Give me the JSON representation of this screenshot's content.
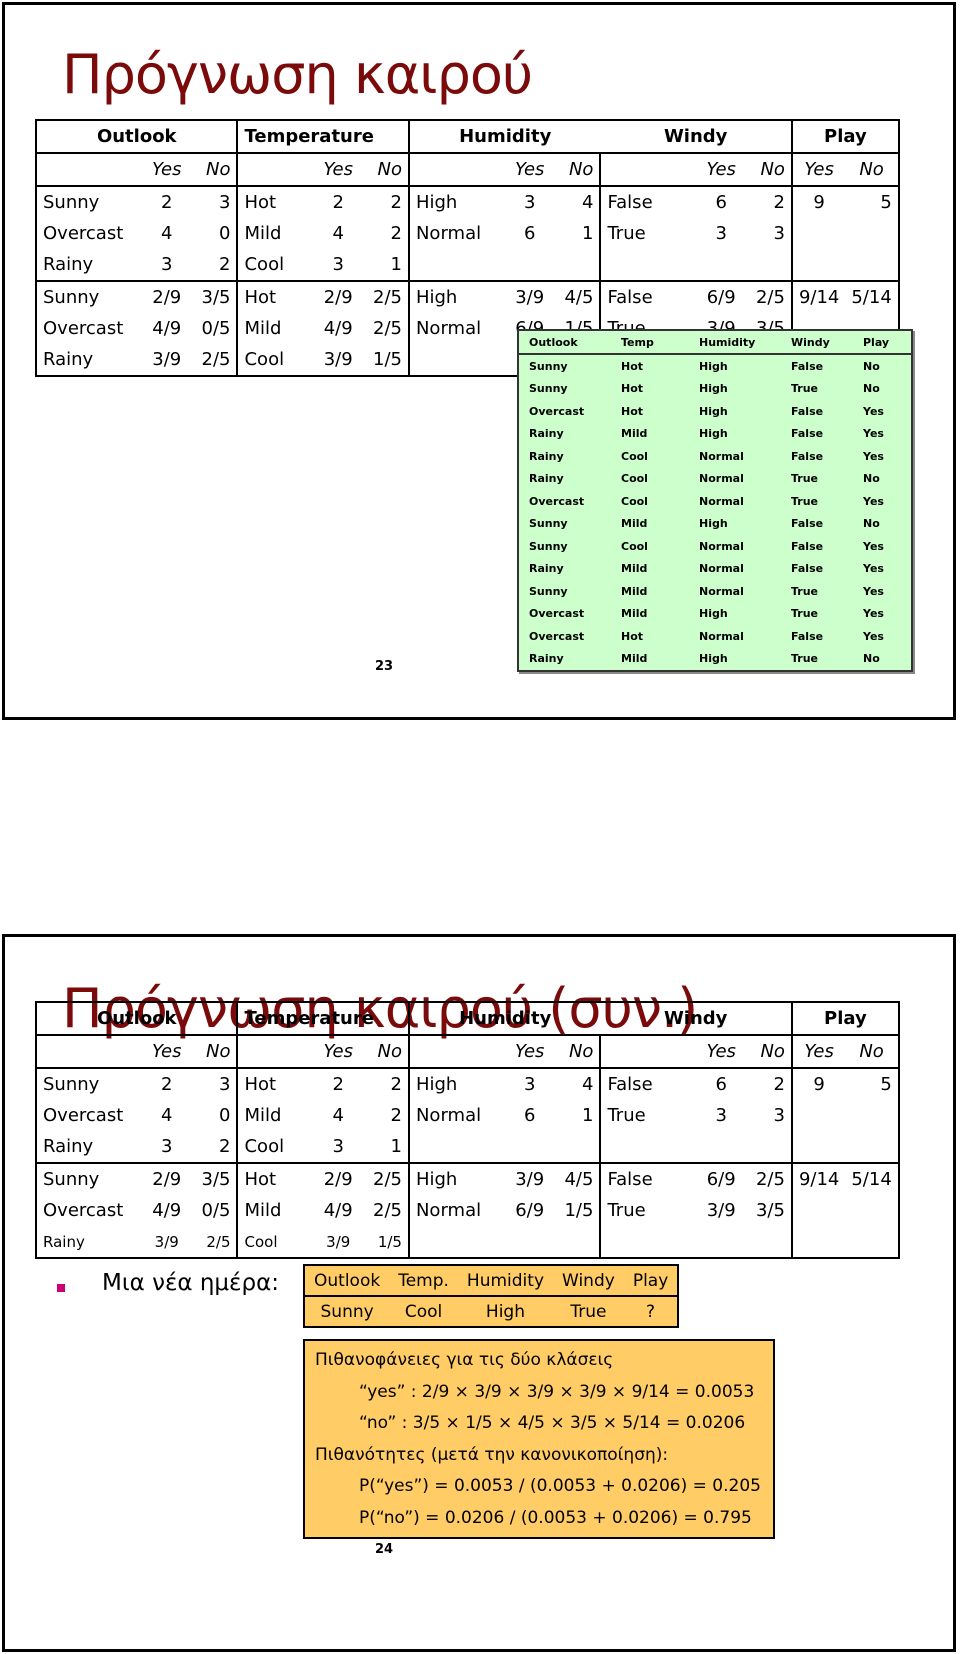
{
  "slides": [
    {
      "title": "Πρόγνωση καιρού",
      "page_number": "23"
    },
    {
      "title": "Πρόγνωση καιρού (συν.)",
      "page_number": "24"
    }
  ],
  "freq_table": {
    "headers": [
      "Outlook",
      "Temperature",
      "Humidity",
      "Windy",
      "Play"
    ],
    "yes_label": "Yes",
    "no_label": "No",
    "counts": [
      {
        "outlook": [
          "Sunny",
          "2",
          "3"
        ],
        "temp": [
          "Hot",
          "2",
          "2"
        ],
        "humidity": [
          "High",
          "3",
          "4"
        ],
        "windy": [
          "False",
          "6",
          "2"
        ],
        "play": [
          "9",
          "5"
        ]
      },
      {
        "outlook": [
          "Overcast",
          "4",
          "0"
        ],
        "temp": [
          "Mild",
          "4",
          "2"
        ],
        "humidity": [
          "Normal",
          "6",
          "1"
        ],
        "windy": [
          "True",
          "3",
          "3"
        ],
        "play": [
          "",
          ""
        ]
      },
      {
        "outlook": [
          "Rainy",
          "3",
          "2"
        ],
        "temp": [
          "Cool",
          "3",
          "1"
        ],
        "humidity": [
          "",
          "",
          ""
        ],
        "windy": [
          "",
          "",
          ""
        ],
        "play": [
          "",
          ""
        ]
      }
    ],
    "ratios": [
      {
        "outlook": [
          "Sunny",
          "2/9",
          "3/5"
        ],
        "temp": [
          "Hot",
          "2/9",
          "2/5"
        ],
        "humidity": [
          "High",
          "3/9",
          "4/5"
        ],
        "windy": [
          "False",
          "6/9",
          "2/5"
        ],
        "play": [
          "9/14",
          "5/14"
        ]
      },
      {
        "outlook": [
          "Overcast",
          "4/9",
          "0/5"
        ],
        "temp": [
          "Mild",
          "4/9",
          "2/5"
        ],
        "humidity": [
          "Normal",
          "6/9",
          "1/5"
        ],
        "windy": [
          "True",
          "3/9",
          "3/5"
        ],
        "play": [
          "",
          ""
        ]
      },
      {
        "outlook": [
          "Rainy",
          "3/9",
          "2/5"
        ],
        "temp": [
          "Cool",
          "3/9",
          "1/5"
        ],
        "humidity": [
          "",
          "",
          ""
        ],
        "windy": [
          "",
          "",
          ""
        ],
        "play": [
          "",
          ""
        ]
      }
    ]
  },
  "dataset": {
    "headers": [
      "Outlook",
      "Temp",
      "Humidity",
      "Windy",
      "Play"
    ],
    "rows": [
      [
        "Sunny",
        "Hot",
        "High",
        "False",
        "No"
      ],
      [
        "Sunny",
        "Hot",
        "High",
        "True",
        "No"
      ],
      [
        "Overcast",
        "Hot",
        "High",
        "False",
        "Yes"
      ],
      [
        "Rainy",
        "Mild",
        "High",
        "False",
        "Yes"
      ],
      [
        "Rainy",
        "Cool",
        "Normal",
        "False",
        "Yes"
      ],
      [
        "Rainy",
        "Cool",
        "Normal",
        "True",
        "No"
      ],
      [
        "Overcast",
        "Cool",
        "Normal",
        "True",
        "Yes"
      ],
      [
        "Sunny",
        "Mild",
        "High",
        "False",
        "No"
      ],
      [
        "Sunny",
        "Cool",
        "Normal",
        "False",
        "Yes"
      ],
      [
        "Rainy",
        "Mild",
        "Normal",
        "False",
        "Yes"
      ],
      [
        "Sunny",
        "Mild",
        "Normal",
        "True",
        "Yes"
      ],
      [
        "Overcast",
        "Mild",
        "High",
        "True",
        "Yes"
      ],
      [
        "Overcast",
        "Hot",
        "Normal",
        "False",
        "Yes"
      ],
      [
        "Rainy",
        "Mild",
        "High",
        "True",
        "No"
      ]
    ]
  },
  "new_day": {
    "label": "Μια νέα ημέρα:",
    "headers": [
      "Outlook",
      "Temp.",
      "Humidity",
      "Windy",
      "Play"
    ],
    "values": [
      "Sunny",
      "Cool",
      "High",
      "True",
      "?"
    ]
  },
  "calculation": {
    "lines": [
      "Πιθανοφάνειες για τις δύο κλάσεις",
      "“yes” : 2/9 × 3/9 × 3/9 ×  3/9 × 9/14 = 0.0053",
      "“no” : 3/5 × 1/5 × 4/5 × 3/5 × 5/14 = 0.0206",
      "Πιθανότητες (μετά την κανονικοποίηση):",
      "P(“yes”) = 0.0053 / (0.0053 + 0.0206) = 0.205",
      "P(“no”) = 0.0206 / (0.0053 + 0.0206) = 0.795"
    ]
  },
  "colors": {
    "title": "#7b0a0a",
    "dataset_bg": "#ccffcc",
    "new_day_bg": "#ffcc66",
    "bullet": "#cc0077"
  }
}
